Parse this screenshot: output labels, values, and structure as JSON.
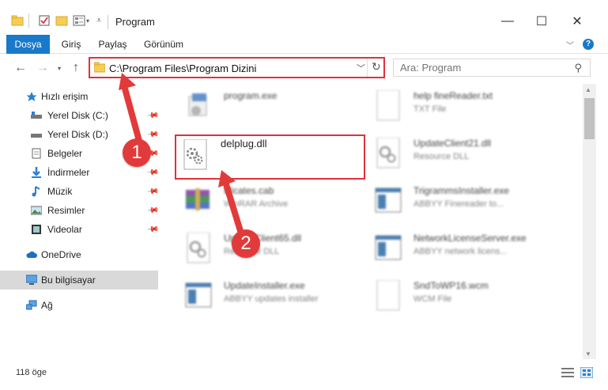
{
  "window": {
    "title": "Program",
    "minimize": "—",
    "maximize": "☐",
    "close": "✕"
  },
  "ribbon": {
    "tabs": [
      "Dosya",
      "Giriş",
      "Paylaş",
      "Görünüm"
    ],
    "help": "?"
  },
  "address": {
    "path": "C:\\Program Files\\Program Dizini"
  },
  "search": {
    "placeholder": "Ara: Program"
  },
  "sidebar": {
    "items": [
      {
        "label": "Hızlı erişim",
        "icon": "star-icon"
      },
      {
        "label": "Yerel Disk (C:)",
        "icon": "drive-icon",
        "pinned": true
      },
      {
        "label": "Yerel Disk (D:)",
        "icon": "drive-icon",
        "pinned": true
      },
      {
        "label": "Belgeler",
        "icon": "documents-icon",
        "pinned": true
      },
      {
        "label": "İndirmeler",
        "icon": "download-icon",
        "pinned": true
      },
      {
        "label": "Müzik",
        "icon": "music-icon",
        "pinned": true
      },
      {
        "label": "Resimler",
        "icon": "pictures-icon",
        "pinned": true
      },
      {
        "label": "Videolar",
        "icon": "video-icon",
        "pinned": true
      },
      {
        "label": "OneDrive",
        "icon": "cloud-icon"
      },
      {
        "label": "Bu bilgisayar",
        "icon": "computer-icon",
        "selected": true
      },
      {
        "label": "Ağ",
        "icon": "network-icon"
      }
    ]
  },
  "files": [
    {
      "name": "program.exe",
      "type": "",
      "icon": "program-icon"
    },
    {
      "name": "delplug.dll",
      "type": "",
      "icon": "dll-gear-icon",
      "highlighted": true
    },
    {
      "name": "tificates.cab",
      "type": "WinRAR Archive",
      "icon": "archive-icon"
    },
    {
      "name": "UpdateClient65.dll",
      "type": "Resource DLL",
      "icon": "dll-gear-icon"
    },
    {
      "name": "UpdateInstaller.exe",
      "type": "ABBYY updates installer",
      "icon": "app-icon"
    },
    {
      "name": "help fineReader.txt",
      "type": "TXT File",
      "icon": "text-file-icon"
    },
    {
      "name": "UpdateClient21.dll",
      "type": "Resource DLL",
      "icon": "dll-gear-icon"
    },
    {
      "name": "TrigrammsInstaller.exe",
      "type": "ABBYY Finereader to...",
      "icon": "app-icon"
    },
    {
      "name": "NetworkLicenseServer.exe",
      "type": "ABBYY network licens...",
      "icon": "app-icon"
    },
    {
      "name": "SndToWP16.wcm",
      "type": "WCM File",
      "icon": "text-file-icon"
    }
  ],
  "status": {
    "count": "118 öge"
  },
  "annotations": {
    "step1": "1",
    "step2": "2"
  },
  "colors": {
    "accent": "#1979ca",
    "highlight_red": "#e0313a"
  }
}
